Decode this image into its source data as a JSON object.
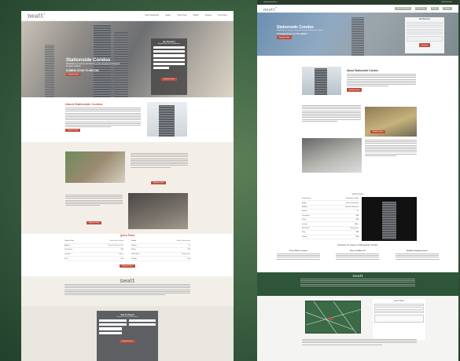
{
  "left_page": {
    "logo": "neatt",
    "nav": [
      "About Stationside",
      "Gallery",
      "Quick Facts",
      "Builder",
      "Register",
      "Floor Plans"
    ],
    "hero": {
      "title": "Stationside Condos",
      "subtitle": "Stationside is a new pre-construction condo development located in the heart of Milton.",
      "cta_line": "COMING SOON TO MILTON",
      "button": "Register Now"
    },
    "form": {
      "title": "Be The First",
      "subtitle": "Register Now for Priority Access",
      "button": "Register Now"
    },
    "about": {
      "title": "About Stationside Condos",
      "button": "Register Now"
    },
    "feature_buttons": [
      "Register Now",
      "Register Now"
    ],
    "facts": {
      "title": "Quick Facts",
      "rows": [
        [
          "Project Name",
          "Stationside Condos"
        ],
        [
          "Builder",
          "Neatt Communities"
        ],
        [
          "Address",
          "Main St & Bronte St S"
        ],
        [
          "Storeys",
          "22"
        ],
        [
          "Occupancy",
          "TBA"
        ],
        [
          "Suites",
          "TBA"
        ],
        [
          "Location",
          "Milton"
        ],
        [
          "Sale Status",
          "Registration"
        ],
        [
          "Price",
          "TBA"
        ],
        [
          "Parking",
          "TBA"
        ]
      ],
      "button": "Register Now"
    },
    "footer_logo": "neatt",
    "contact": {
      "title": "Get In Touch",
      "subtitle": "Register For More Information",
      "button": "Register Now"
    }
  },
  "right_page": {
    "topbar_left": "info@stationside.ca",
    "topbar_right": "(416) 555-0000",
    "nav": [
      "About Stationside",
      "Quick Facts",
      "Builder",
      "Register"
    ],
    "hero": {
      "title": "Stationside Condos",
      "subtitle": "Stationside is a new pre-construction condo development in Milton.",
      "cta_line": "Coming Soon To The Wider",
      "button": "Register Now"
    },
    "form": {
      "title": "Be The First",
      "button": "Register"
    },
    "about": {
      "title": "About Stationside Condos",
      "button": "Register Now"
    },
    "feature_buttons": [
      "Register Now"
    ],
    "facts": {
      "title": "Quick Facts",
      "rows": [
        [
          "Project Name",
          "Stationside Condos"
        ],
        [
          "Builder",
          "Neatt Communities"
        ],
        [
          "Address",
          "Main St & Bronte St"
        ],
        [
          "Storeys",
          "22"
        ],
        [
          "Occupancy",
          "TBA"
        ],
        [
          "Suites",
          "TBA"
        ],
        [
          "Location",
          "Milton"
        ],
        [
          "Sale Status",
          "Registration"
        ],
        [
          "Price",
          "TBA"
        ],
        [
          "Parking",
          "TBA"
        ]
      ]
    },
    "reasons": {
      "title": "Reasons To Invest In Stationside Condos",
      "items": [
        "Prime Milton Location",
        "Steps To Milton GO",
        "Walkable Neighbourhood"
      ]
    },
    "footer_logo": "neatt",
    "contact": {
      "title": "Get In Touch"
    }
  }
}
